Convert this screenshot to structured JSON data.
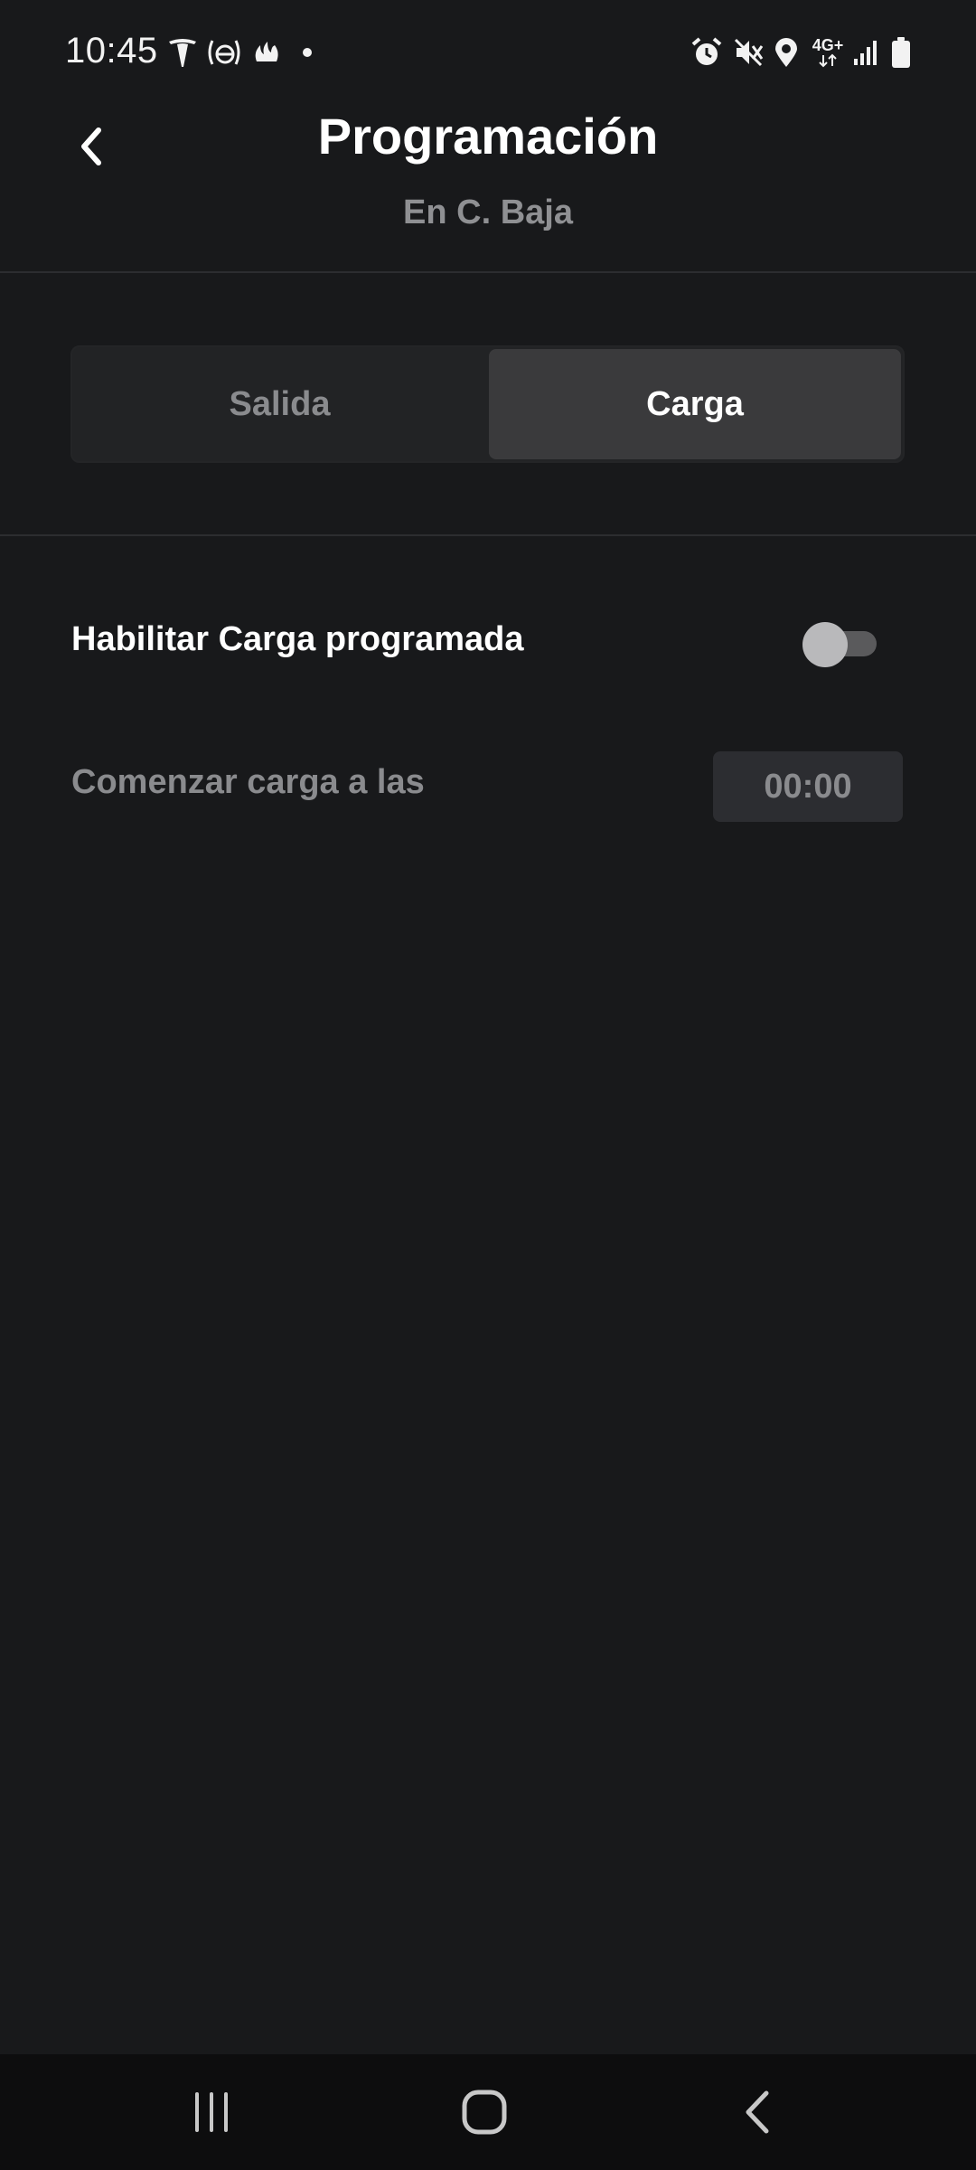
{
  "status_bar": {
    "time": "10:45",
    "left_icons": [
      "tesla-icon",
      "e-app-icon",
      "flame-icon",
      "dot-icon"
    ],
    "network_label": "4G+",
    "right_icons": [
      "alarm-icon",
      "mute-icon",
      "location-icon",
      "network-4g-icon",
      "signal-icon",
      "battery-icon"
    ]
  },
  "header": {
    "title": "Programación",
    "subtitle": "En C. Baja"
  },
  "tabs": [
    {
      "label": "Salida",
      "selected": false
    },
    {
      "label": "Carga",
      "selected": true
    }
  ],
  "settings": {
    "enable_label": "Habilitar Carga programada",
    "enable_on": false,
    "start_label": "Comenzar carga a las",
    "start_time": "00:00"
  },
  "nav_bar": {
    "icons": [
      "recent-apps-icon",
      "home-icon",
      "nav-back-icon"
    ]
  },
  "colors": {
    "background": "#18191b",
    "active_segment": "#3a3a3c",
    "muted_text": "#8a8b8e"
  }
}
